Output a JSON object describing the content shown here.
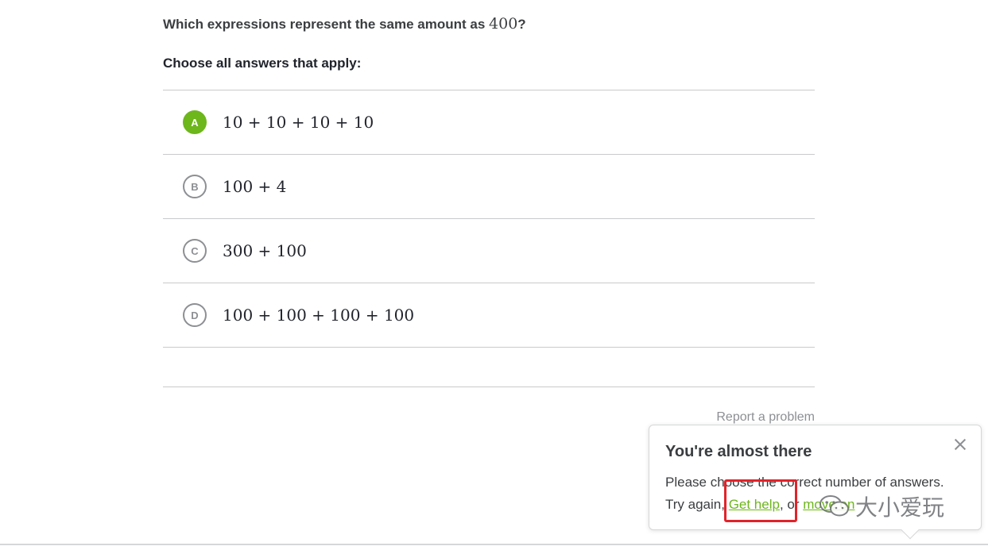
{
  "question": {
    "text": "Which expressions represent the same amount as ",
    "number": "400",
    "end": "?"
  },
  "instruction": "Choose all answers that apply:",
  "choices": [
    {
      "letter": "A",
      "expression": "10 + 10 + 10 + 10",
      "selected": true
    },
    {
      "letter": "B",
      "expression": "100 + 4",
      "selected": false
    },
    {
      "letter": "C",
      "expression": "300 + 100",
      "selected": false
    },
    {
      "letter": "D",
      "expression": "100 + 100 + 100 + 100",
      "selected": false
    }
  ],
  "report_link": "Report a problem",
  "popover": {
    "title": "You're almost there",
    "line1": "Please choose the correct number of answers.",
    "try_again": "Try again, ",
    "get_help": "Get help",
    "or": ", or ",
    "move_on": "move on"
  },
  "watermark": "大小爱玩",
  "colors": {
    "accent_green": "#6db61c",
    "highlight_red": "#e1232a",
    "text_dark": "#21242c",
    "text_gray": "#8d8f93"
  }
}
